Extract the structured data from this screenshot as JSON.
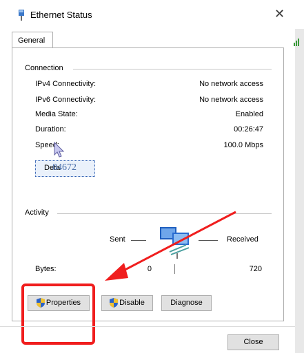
{
  "window": {
    "title": "Ethernet Status"
  },
  "tabs": [
    {
      "label": "General"
    }
  ],
  "connection": {
    "group_label": "Connection",
    "rows": [
      {
        "label": "IPv4 Connectivity:",
        "value": "No network access"
      },
      {
        "label": "IPv6 Connectivity:",
        "value": "No network access"
      },
      {
        "label": "Media State:",
        "value": "Enabled"
      },
      {
        "label": "Duration:",
        "value": "00:26:47"
      },
      {
        "label": "Speed:",
        "value": "100.0 Mbps"
      }
    ],
    "details_button": "Deta",
    "overlay_text": "84672"
  },
  "activity": {
    "group_label": "Activity",
    "sent_label": "Sent",
    "received_label": "Received",
    "bytes_label": "Bytes:",
    "bytes_sent": "0",
    "bytes_received": "720"
  },
  "buttons": {
    "properties": "Properties",
    "disable": "Disable",
    "diagnose": "Diagnose",
    "close": "Close"
  },
  "icons": [
    "ethernet-icon",
    "close-icon",
    "shield-icon",
    "network-activity-icon",
    "cursor-icon"
  ],
  "colors": {
    "annotation": "#f01e1e",
    "focus": "#2a5bb0"
  }
}
